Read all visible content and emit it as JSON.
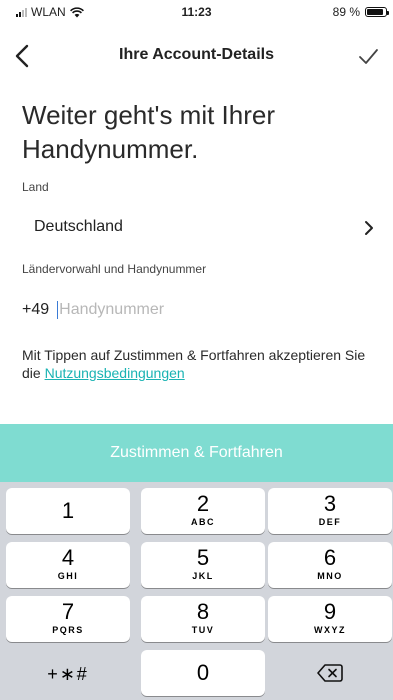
{
  "status_bar": {
    "carrier": "WLAN",
    "time": "11:23",
    "battery": "89 %",
    "battery_level": 0.89
  },
  "nav": {
    "title": "Ihre Account-Details",
    "back_icon": "chevron-left-icon",
    "confirm_icon": "checkmark-icon"
  },
  "heading": "Weiter geht's mit Ihrer Handynummer.",
  "country": {
    "label": "Land",
    "value": "Deutschland",
    "icon": "chevron-right-icon"
  },
  "phone": {
    "label": "Ländervorwahl und Handynummer",
    "prefix": "+49",
    "value": "",
    "placeholder": "Handynummer"
  },
  "terms": {
    "text": "Mit Tippen auf Zustimmen & Fortfahren akzeptieren Sie die ",
    "link": "Nutzungsbedingungen"
  },
  "agree_button": "Zustimmen & Fortfahren",
  "accent_color": "#7fdcd1",
  "link_color": "#1ab3b3",
  "keypad": {
    "keys": [
      {
        "digit": "1",
        "letters": ""
      },
      {
        "digit": "2",
        "letters": "ABC"
      },
      {
        "digit": "3",
        "letters": "DEF"
      },
      {
        "digit": "4",
        "letters": "GHI"
      },
      {
        "digit": "5",
        "letters": "JKL"
      },
      {
        "digit": "6",
        "letters": "MNO"
      },
      {
        "digit": "7",
        "letters": "PQRS"
      },
      {
        "digit": "8",
        "letters": "TUV"
      },
      {
        "digit": "9",
        "letters": "WXYZ"
      },
      {
        "digit": "+∗#",
        "letters": ""
      },
      {
        "digit": "0",
        "letters": ""
      },
      {
        "digit": "",
        "letters": ""
      }
    ],
    "delete_icon": "backspace-icon"
  }
}
